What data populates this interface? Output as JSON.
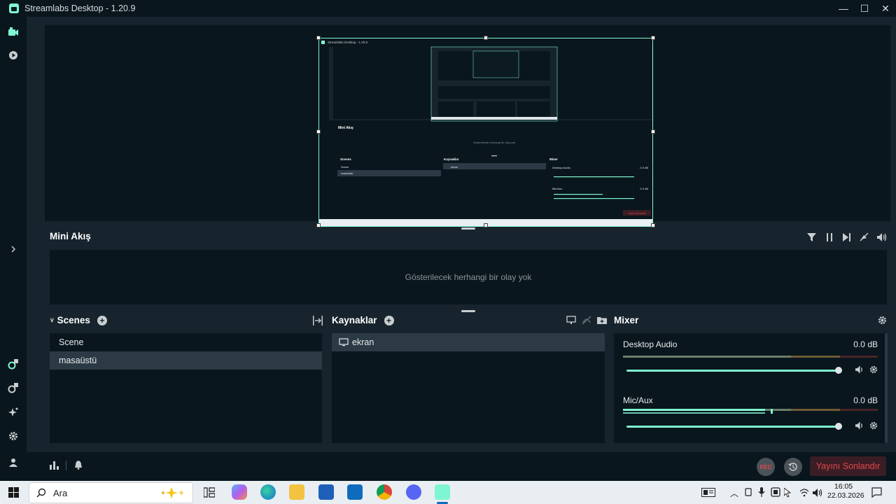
{
  "window": {
    "title": "Streamlabs Desktop - 1.20.9",
    "min_glyph": "—",
    "max_glyph": "☐",
    "close_glyph": "✕"
  },
  "mini_feed": {
    "title": "Mini Akış",
    "empty_text": "Gösterilecek herhangi bir olay yok"
  },
  "scenes": {
    "title": "Scenes",
    "items": [
      "Scene",
      "masaüstü"
    ],
    "active_index": 1
  },
  "sources": {
    "title": "Kaynaklar",
    "items": [
      "ekran"
    ]
  },
  "mixer": {
    "title": "Mixer",
    "channels": [
      {
        "name": "Desktop Audio",
        "db": "0.0 dB",
        "volume": 1.0
      },
      {
        "name": "Mic/Aux",
        "db": "0.0 dB",
        "volume": 1.0,
        "level": 0.6
      }
    ]
  },
  "footer": {
    "rec_label": "REC",
    "end_stream_label": "Yayını Sonlandır"
  },
  "taskbar": {
    "search_placeholder": "Ara",
    "time": "16:05",
    "date": "22.03.2026"
  },
  "nested_preview": {
    "title": "Streamlabs Desktop - 1.20.9",
    "mini_title": "Mini Akış",
    "empty_text": "Gösterilecek herhangi bir olay yok",
    "scenes_title": "Scenes",
    "sources_title": "Kaynaklar",
    "mixer_title": "Mixer",
    "scene_items": [
      "Scene",
      "masaüstü"
    ],
    "source_item": "ekran",
    "desktop_audio": "Desktop Audio",
    "mic_aux": "Mic/Aux",
    "db": "0.0 dB",
    "end_label": "Yayını Sonlandır"
  },
  "colors": {
    "accent": "#80f5d2",
    "panel_bg": "#09161d",
    "main_bg": "#17242d",
    "danger": "#e0474b"
  }
}
